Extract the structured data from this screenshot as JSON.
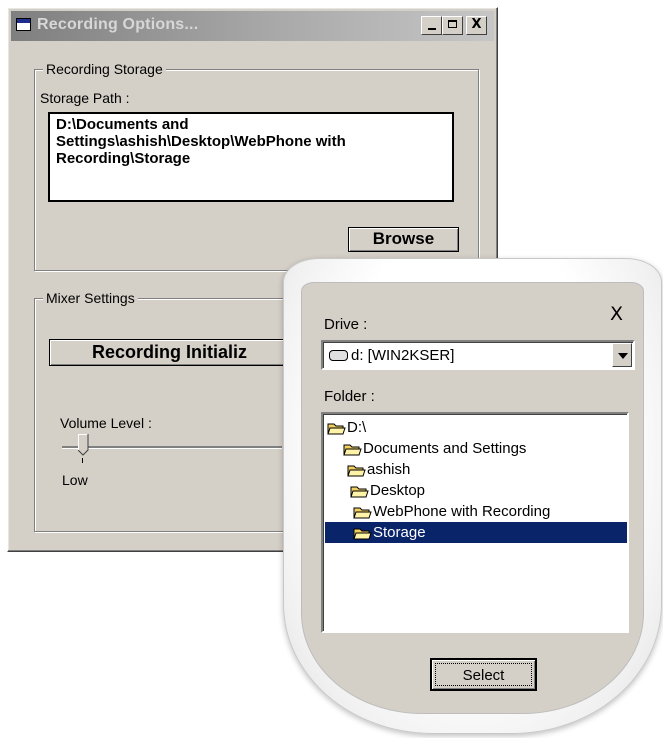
{
  "window": {
    "title": "Recording Options...",
    "controls": {
      "minimize": "_",
      "maximize": "□",
      "close": "X"
    }
  },
  "storage": {
    "group_label": "Recording Storage",
    "path_label": "Storage Path :",
    "path_lines": [
      "D:\\Documents and",
      "Settings\\ashish\\Desktop\\WebPhone with",
      "Recording\\Storage"
    ],
    "browse_label": "Browse"
  },
  "mixer": {
    "group_label": "Mixer Settings",
    "status_button_label": "Recording Initializ",
    "volume_label": "Volume Level :",
    "low_label": "Low",
    "volume_level": 0.1
  },
  "browser": {
    "close_label": "X",
    "drive_label": "Drive :",
    "drive_value": "d: [WIN2KSER]",
    "folder_label": "Folder :",
    "folders": [
      {
        "name": "D:\\",
        "depth": 0
      },
      {
        "name": "Documents and Settings",
        "depth": 1
      },
      {
        "name": "ashish",
        "depth": 2
      },
      {
        "name": "Desktop",
        "depth": 3
      },
      {
        "name": "WebPhone with Recording",
        "depth": 4
      },
      {
        "name": "Storage",
        "depth": 5,
        "selected": true
      }
    ],
    "select_label": "Select"
  },
  "colors": {
    "face": "#d4d0c8",
    "selection": "#0a246a",
    "folder": "#f0d060"
  }
}
